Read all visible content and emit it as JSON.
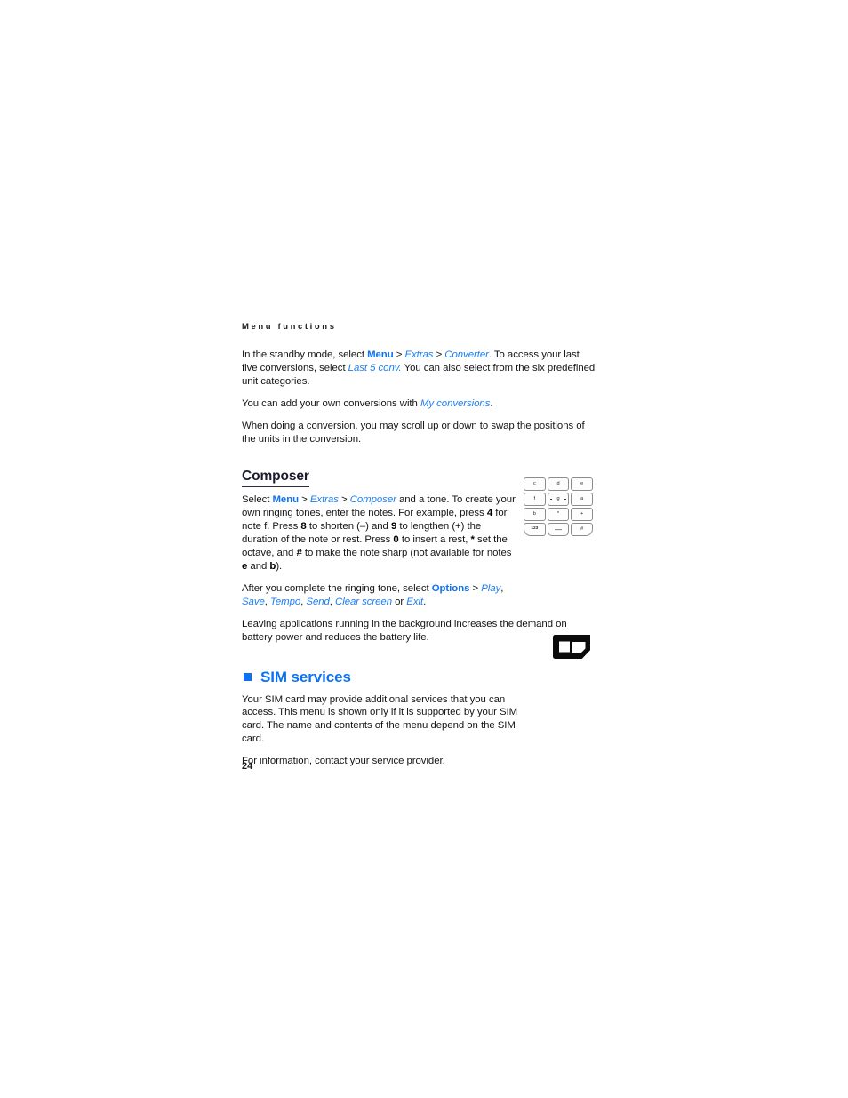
{
  "header": {
    "running_title": "Menu functions"
  },
  "converter": {
    "p1_a": "In the standby mode, select ",
    "p1_menu": "Menu",
    "p1_gt1": " > ",
    "p1_extras": "Extras",
    "p1_gt2": " > ",
    "p1_converter": "Converter",
    "p1_b": ". To access your last five conversions, select ",
    "p1_last5": "Last 5 conv.",
    "p1_c": " You can also select from the six predefined unit categories.",
    "p2_a": "You can add your own conversions with ",
    "p2_myconv": "My conversions",
    "p2_b": ".",
    "p3": "When doing a conversion, you may scroll up or down to swap the positions of the units in the conversion."
  },
  "composer": {
    "heading": "Composer",
    "p1_a": "Select ",
    "p1_menu": "Menu",
    "p1_gt1": " > ",
    "p1_extras": "Extras",
    "p1_gt2": " > ",
    "p1_composer": "Composer",
    "p1_b": " and a tone. To create your own ringing tones, enter the notes. For example, press ",
    "p1_k4": "4",
    "p1_c": " for note f. Press ",
    "p1_k8": "8",
    "p1_d": " to shorten (–) and ",
    "p1_k9": "9",
    "p1_e": " to lengthen (+) the duration of the note or rest. Press ",
    "p1_k0": "0",
    "p1_f": " to insert a rest, ",
    "p1_kstar": "*",
    "p1_g": " set the octave, and ",
    "p1_khash": "#",
    "p1_h": " to make the note sharp (not available for notes ",
    "p1_ke": "e",
    "p1_i": " and ",
    "p1_kb": "b",
    "p1_j": ").",
    "p2_a": "After you complete the ringing tone, select ",
    "p2_options": "Options",
    "p2_gt": " > ",
    "p2_play": "Play",
    "p2_c1": ", ",
    "p2_save": "Save",
    "p2_c2": ", ",
    "p2_tempo": "Tempo",
    "p2_c3": ", ",
    "p2_send": "Send",
    "p2_c4": ", ",
    "p2_clear": "Clear screen",
    "p2_or": " or ",
    "p2_exit": "Exit",
    "p2_end": ".",
    "p3": "Leaving applications running in the background increases the demand on battery power and reduces the battery life.",
    "keypad": {
      "rows": [
        [
          "c",
          "d",
          "e"
        ],
        [
          "f",
          "g",
          "a"
        ],
        [
          "b",
          "*",
          "+"
        ],
        [
          "123",
          "—",
          "#"
        ]
      ]
    }
  },
  "sim_services": {
    "heading": "SIM services",
    "p1": "Your SIM card may provide additional services that you can access. This menu is shown only if it is supported by your SIM card. The name and contents of the menu depend on the SIM card.",
    "p2": "For information, contact your service provider."
  },
  "folio": {
    "page_number": "24"
  },
  "colors": {
    "link_blue": "#0d72f0",
    "link_blue_italic": "#1b7ef2",
    "body_text": "#141414",
    "heading_dark": "#1b1b2e"
  }
}
